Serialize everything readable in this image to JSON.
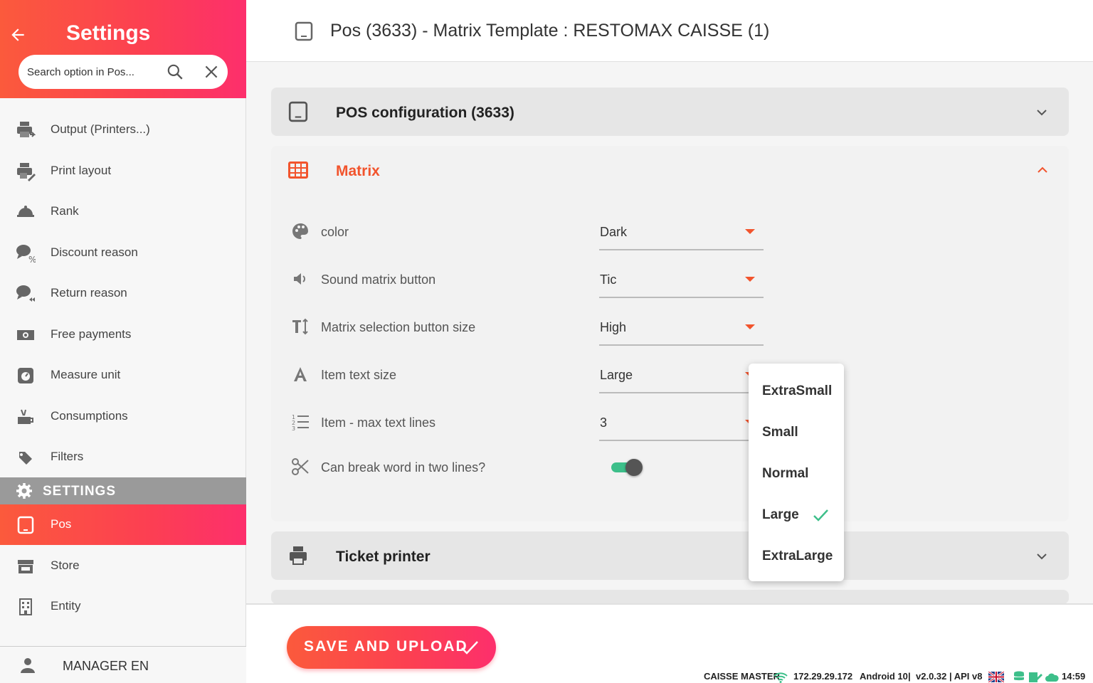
{
  "sidebar": {
    "title": "Settings",
    "search_placeholder": "Search option in Pos...",
    "items": [
      {
        "label": "Output (Printers...)",
        "icon": "printer-out-icon"
      },
      {
        "label": "Print layout",
        "icon": "print-layout-icon"
      },
      {
        "label": "Rank",
        "icon": "rank-icon"
      },
      {
        "label": "Discount reason",
        "icon": "discount-reason-icon"
      },
      {
        "label": "Return reason",
        "icon": "return-reason-icon"
      },
      {
        "label": "Free payments",
        "icon": "free-payments-icon"
      },
      {
        "label": "Measure unit",
        "icon": "measure-unit-icon"
      },
      {
        "label": "Consumptions",
        "icon": "consumptions-icon"
      },
      {
        "label": "Filters",
        "icon": "filters-icon"
      }
    ],
    "section_label": "SETTINGS",
    "settings_items": [
      {
        "label": "Pos",
        "icon": "pos-icon",
        "active": true
      },
      {
        "label": "Store",
        "icon": "store-icon"
      },
      {
        "label": "Entity",
        "icon": "entity-icon"
      }
    ],
    "user_label": "MANAGER EN"
  },
  "header": {
    "title": "Pos (3633) - Matrix Template : RESTOMAX CAISSE (1)"
  },
  "panels": {
    "pos_config_title": "POS configuration  (3633)",
    "matrix_title": "Matrix",
    "ticket_printer_title": "Ticket printer"
  },
  "matrix": {
    "rows": [
      {
        "label": "color",
        "value": "Dark"
      },
      {
        "label": "Sound matrix button",
        "value": "Tic"
      },
      {
        "label": "Matrix selection button size",
        "value": "High"
      },
      {
        "label": "Item text size",
        "value": "Large"
      },
      {
        "label": "Item - max text lines",
        "value": "3"
      }
    ],
    "break_word_label": "Can break word in two lines?",
    "break_word_on": true
  },
  "dropdown": {
    "options": [
      "ExtraSmall",
      "Small",
      "Normal",
      "Large",
      "ExtraLarge"
    ],
    "selected": "Large"
  },
  "footer": {
    "save_label": "SAVE AND UPLOAD",
    "status_app": "CAISSE MASTER",
    "status_ip": "172.29.29.172",
    "status_os": "Android 10",
    "status_version": "v2.0.32 | API v8",
    "status_time": "14:59"
  },
  "colors": {
    "accent": "#f2542d",
    "gradient_start": "#fb5a3c",
    "gradient_end": "#fd2f6c",
    "toggle_on": "#3dbf8a",
    "check_green": "#3dbf8a"
  }
}
